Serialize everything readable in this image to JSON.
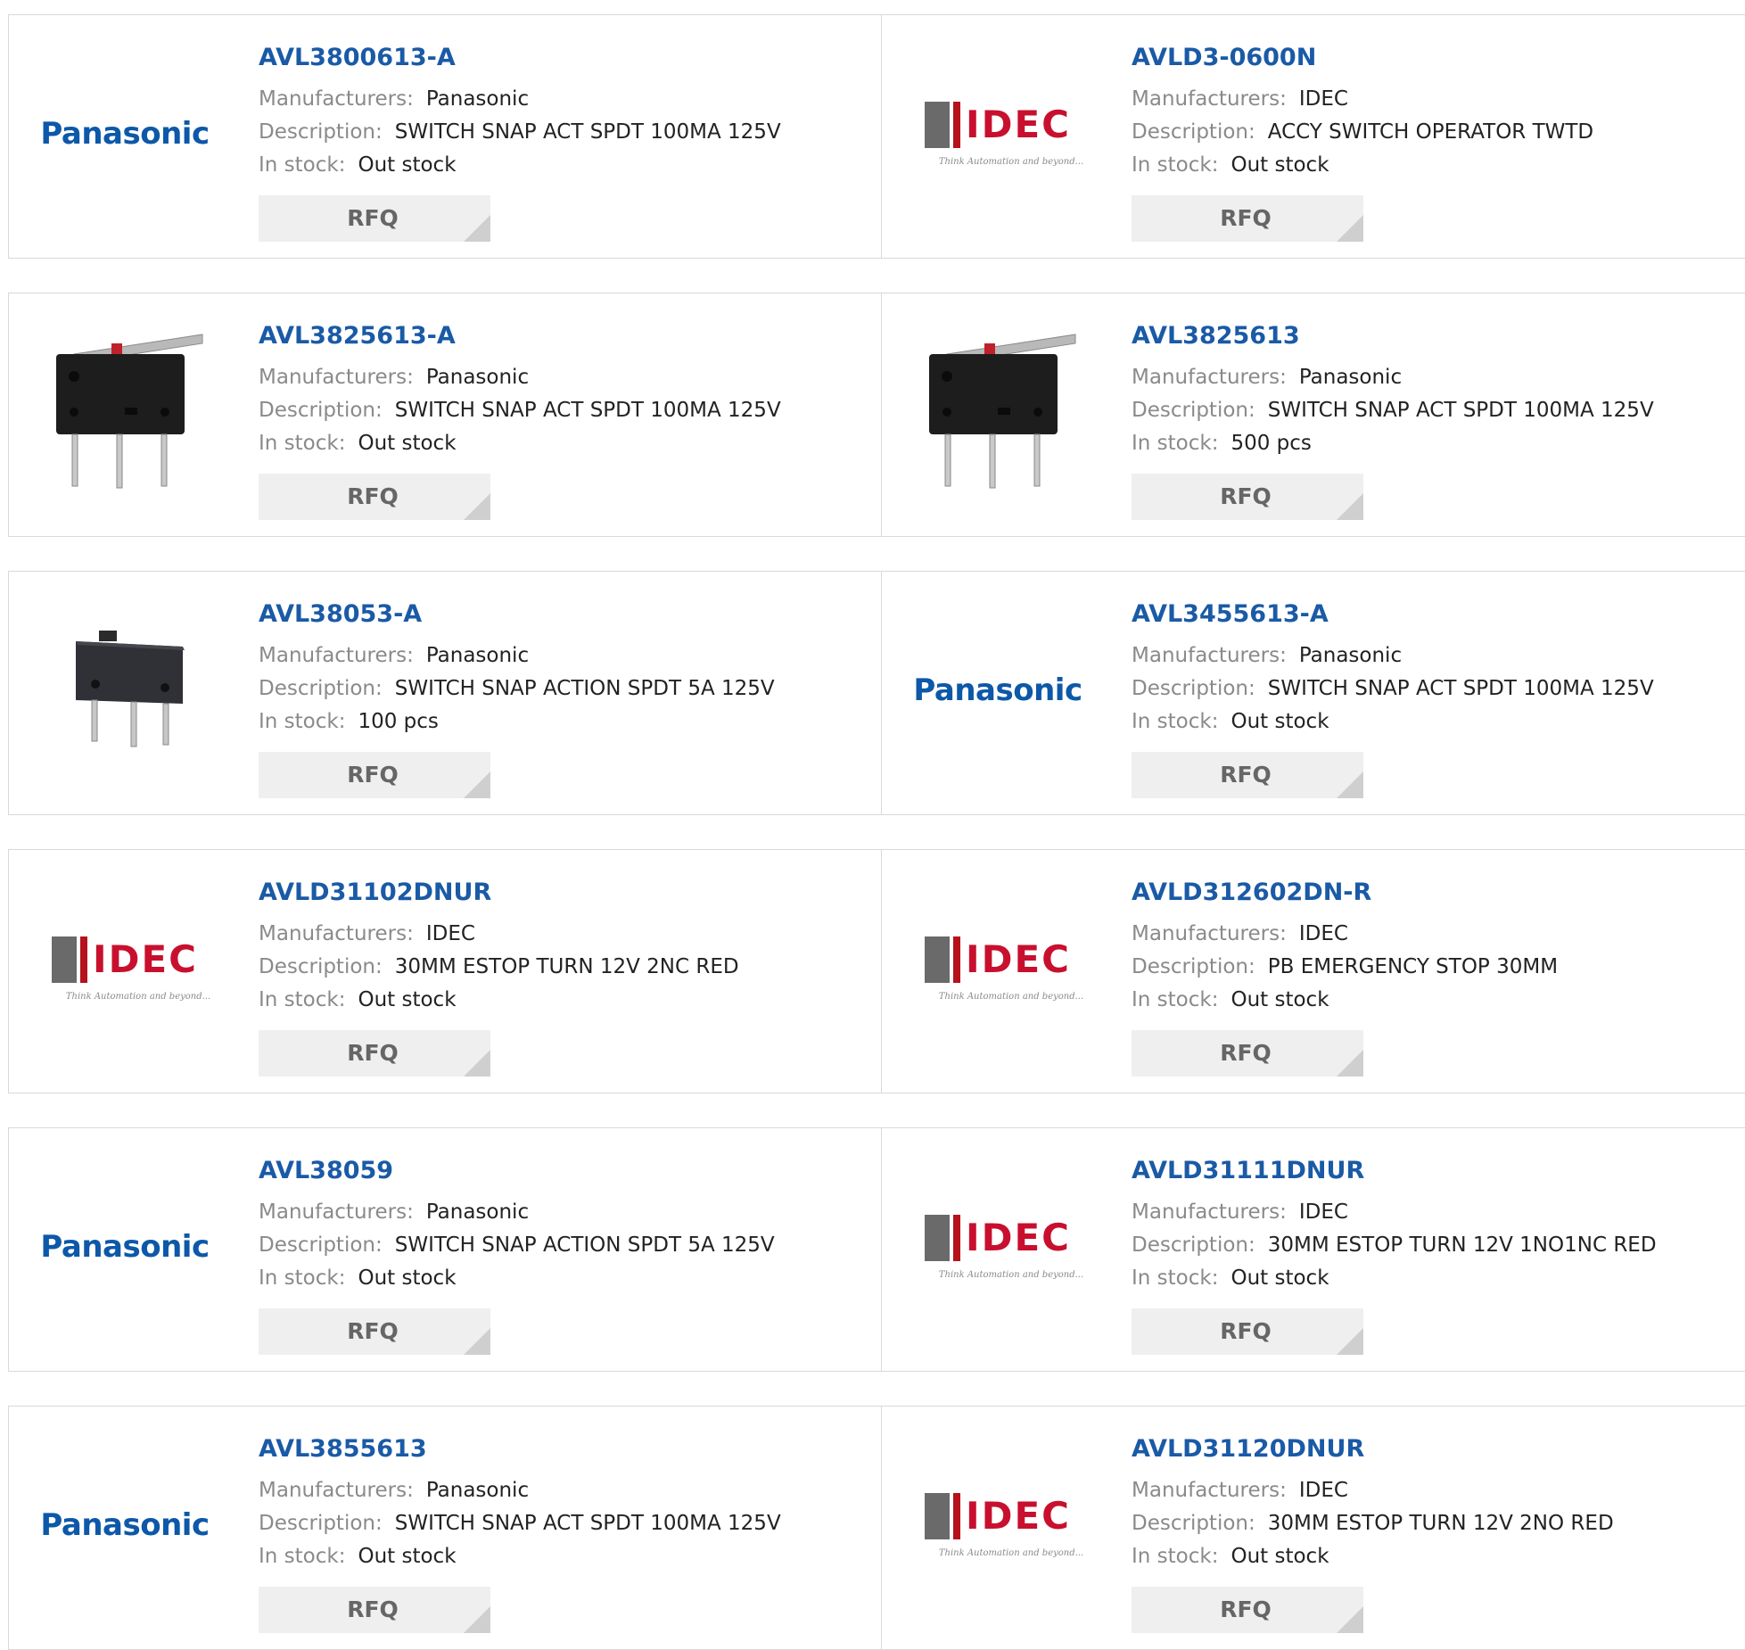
{
  "labels": {
    "manufacturers": "Manufacturers:",
    "description": "Description:",
    "in_stock": "In stock:",
    "rfq": "RFQ"
  },
  "brands": {
    "panasonic": {
      "name": "Panasonic",
      "color": "#0d58a8"
    },
    "idec": {
      "name": "IDEC",
      "tagline": "Think Automation and beyond...",
      "color": "#c8102e"
    }
  },
  "products": [
    {
      "part": "AVL3800613-A",
      "manufacturer": "Panasonic",
      "description": "SWITCH SNAP ACT SPDT 100MA 125V",
      "stock": "Out stock",
      "image": "panasonic-logo"
    },
    {
      "part": "AVLD3-0600N",
      "manufacturer": "IDEC",
      "description": "ACCY SWITCH OPERATOR TWTD",
      "stock": "Out stock",
      "image": "idec-logo"
    },
    {
      "part": "AVL3825613-A",
      "manufacturer": "Panasonic",
      "description": "SWITCH SNAP ACT SPDT 100MA 125V",
      "stock": "Out stock",
      "image": "lever-switch-photo"
    },
    {
      "part": "AVL3825613",
      "manufacturer": "Panasonic",
      "description": "SWITCH SNAP ACT SPDT 100MA 125V",
      "stock": "500 pcs",
      "image": "lever-switch-photo"
    },
    {
      "part": "AVL38053-A",
      "manufacturer": "Panasonic",
      "description": "SWITCH SNAP ACTION SPDT 5A 125V",
      "stock": "100 pcs",
      "image": "micro-switch-photo"
    },
    {
      "part": "AVL3455613-A",
      "manufacturer": "Panasonic",
      "description": "SWITCH SNAP ACT SPDT 100MA 125V",
      "stock": "Out stock",
      "image": "panasonic-logo"
    },
    {
      "part": "AVLD31102DNUR",
      "manufacturer": "IDEC",
      "description": "30MM ESTOP TURN 12V 2NC RED",
      "stock": "Out stock",
      "image": "idec-logo"
    },
    {
      "part": "AVLD312602DN-R",
      "manufacturer": "IDEC",
      "description": "PB EMERGENCY STOP 30MM",
      "stock": "Out stock",
      "image": "idec-logo"
    },
    {
      "part": "AVL38059",
      "manufacturer": "Panasonic",
      "description": "SWITCH SNAP ACTION SPDT 5A 125V",
      "stock": "Out stock",
      "image": "panasonic-logo"
    },
    {
      "part": "AVLD31111DNUR",
      "manufacturer": "IDEC",
      "description": "30MM ESTOP TURN 12V 1NO1NC RED",
      "stock": "Out stock",
      "image": "idec-logo"
    },
    {
      "part": "AVL3855613",
      "manufacturer": "Panasonic",
      "description": "SWITCH SNAP ACT SPDT 100MA 125V",
      "stock": "Out stock",
      "image": "panasonic-logo"
    },
    {
      "part": "AVLD31120DNUR",
      "manufacturer": "IDEC",
      "description": "30MM ESTOP TURN 12V 2NO RED",
      "stock": "Out stock",
      "image": "idec-logo"
    }
  ]
}
